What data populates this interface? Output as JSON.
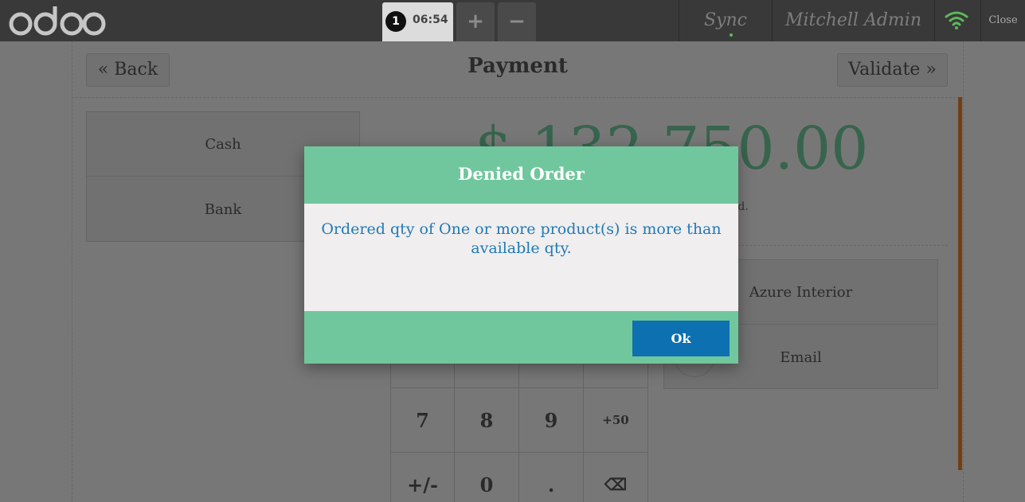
{
  "topbar": {
    "logo_text": "odoo",
    "order": {
      "number": "1",
      "time": "06:54"
    },
    "add_label": "+",
    "remove_label": "−",
    "sync_label": "Sync",
    "user_label": "Mitchell Admin",
    "close_label": "Close"
  },
  "screen": {
    "back_label": "« Back",
    "title": "Payment",
    "validate_label": "Validate »",
    "payment_methods": [
      "Cash",
      "Bank"
    ],
    "total": "$ 132,750.00",
    "hint_text": "od.",
    "customer": "Azure Interior",
    "email_label": "Email",
    "numpad": {
      "row1": [
        "7",
        "8",
        "9",
        "+50"
      ],
      "row2": [
        "+/-",
        "0",
        ".",
        "⌫"
      ]
    }
  },
  "popup": {
    "title": "Denied Order",
    "body": "Ordered qty of One or more product(s) is more than available qty.",
    "ok_label": "Ok"
  },
  "colors": {
    "topbar": "#393939",
    "popup_header": "#71c79d",
    "ok_button": "#0d70b0",
    "body_text": "#1f7ab6",
    "total": "#6ec89b",
    "progress_bar": "#e67e22"
  }
}
